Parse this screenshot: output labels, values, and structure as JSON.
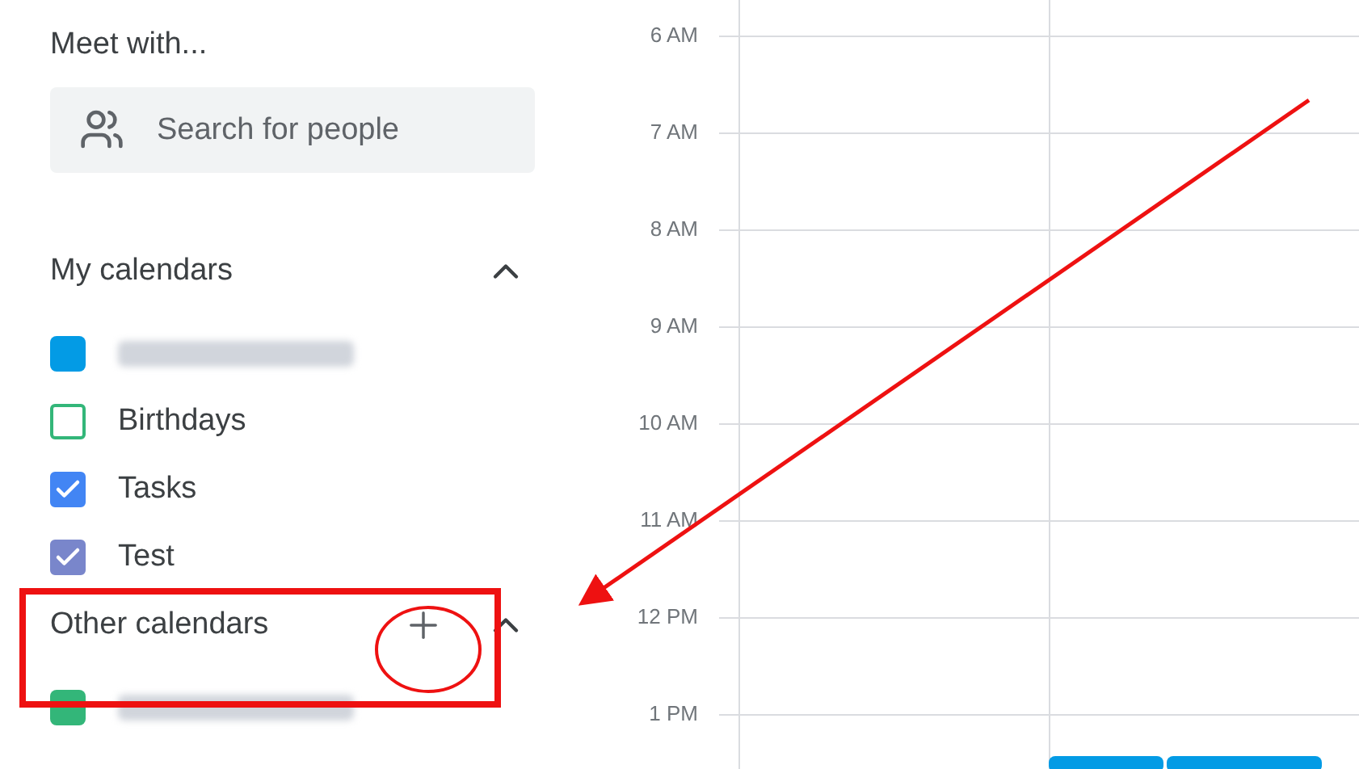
{
  "sidebar": {
    "meet_with": {
      "title": "Meet with...",
      "search": {
        "placeholder": "Search for people"
      }
    },
    "sections": [
      {
        "title": "My calendars",
        "expanded": true,
        "add_button": false,
        "items": [
          {
            "kind": "redacted",
            "color": "#039be5"
          },
          {
            "kind": "checkbox",
            "label": "Birthdays",
            "checked": false,
            "color": "#33b679"
          },
          {
            "kind": "checkbox",
            "label": "Tasks",
            "checked": true,
            "color": "#4285f4"
          },
          {
            "kind": "checkbox",
            "label": "Test",
            "checked": true,
            "color": "#7986cb"
          }
        ]
      },
      {
        "title": "Other calendars",
        "expanded": true,
        "add_button": true,
        "items": [
          {
            "kind": "redacted",
            "color": "#33b679"
          }
        ]
      }
    ]
  },
  "grid": {
    "hours": [
      "6 AM",
      "7 AM",
      "8 AM",
      "9 AM",
      "10 AM",
      "11 AM",
      "12 PM",
      "1 PM"
    ],
    "events": [
      {
        "color": "#039be5"
      },
      {
        "color": "#039be5"
      }
    ]
  },
  "annotations": [
    {
      "kind": "box"
    },
    {
      "kind": "circle"
    },
    {
      "kind": "arrow"
    }
  ]
}
